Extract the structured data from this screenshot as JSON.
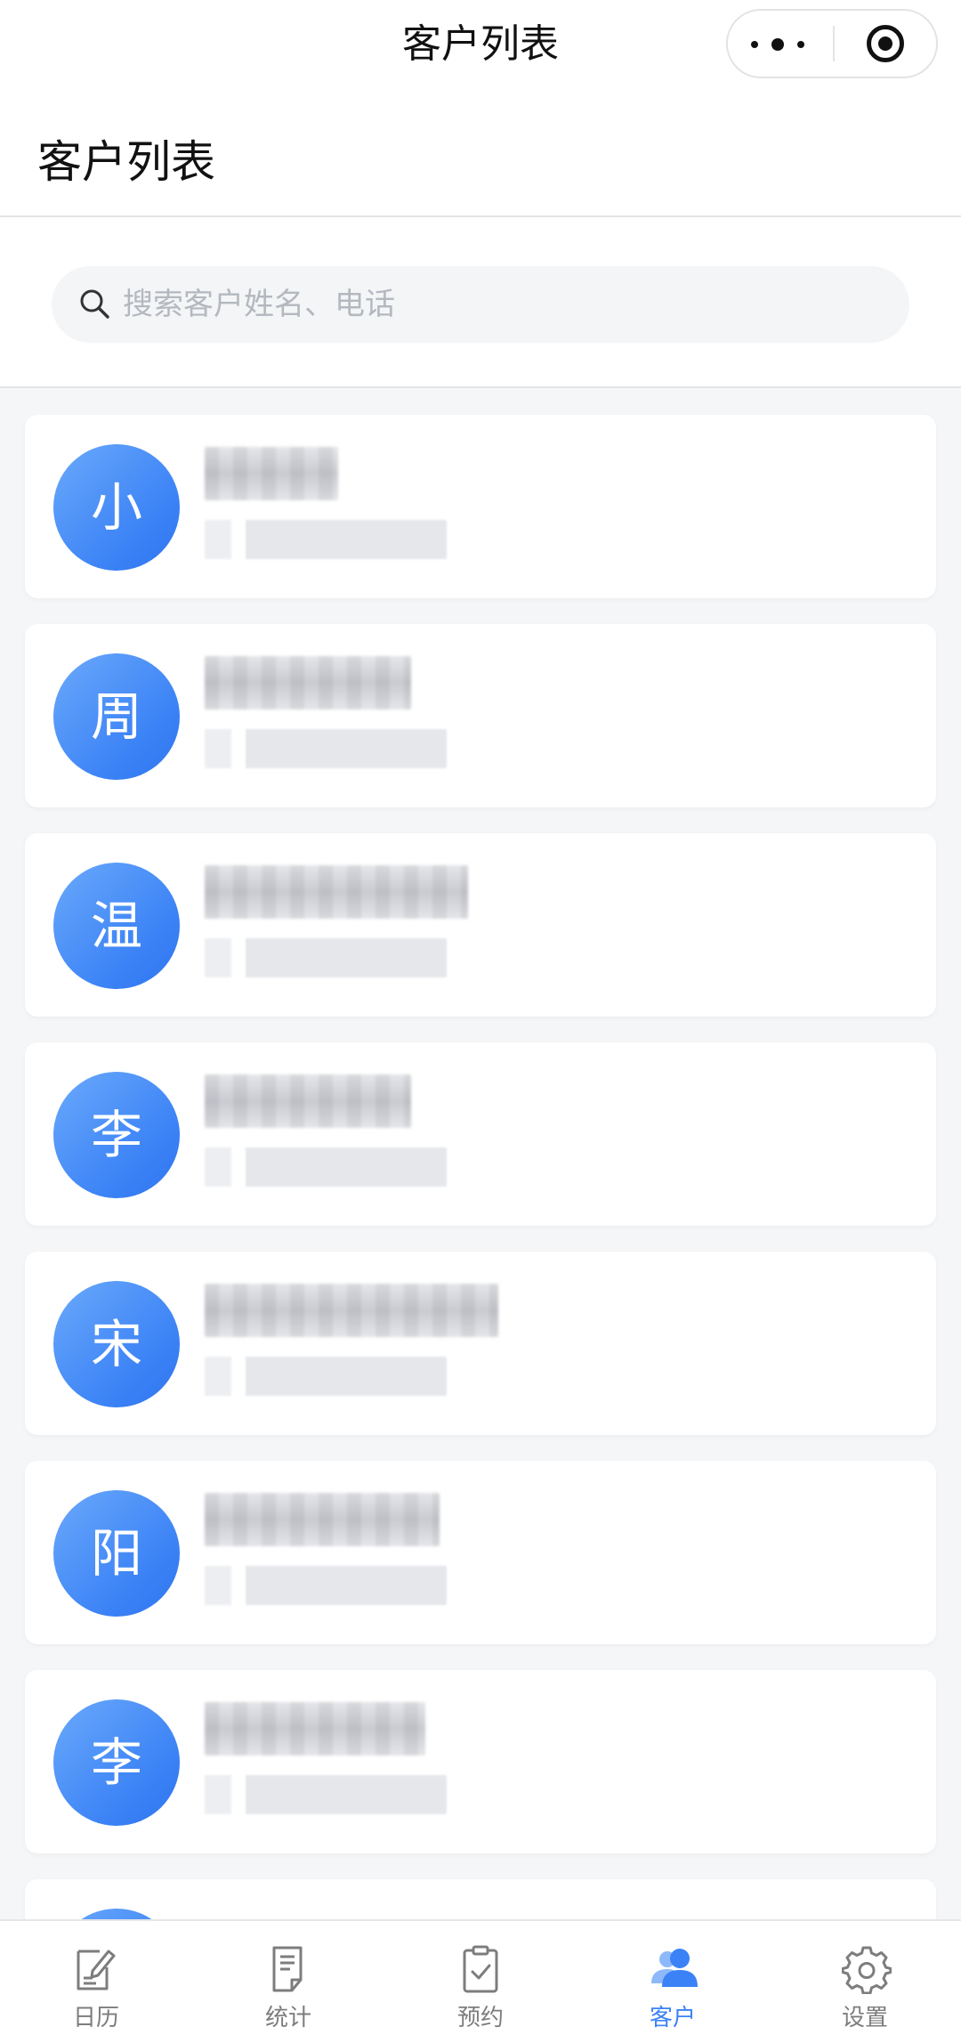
{
  "navbar": {
    "title": "客户列表",
    "more_icon": "more-dots-icon",
    "close_icon": "mini-program-close-icon"
  },
  "page": {
    "title": "客户列表"
  },
  "search": {
    "placeholder": "搜索客户姓名、电话",
    "value": "",
    "icon": "search-icon"
  },
  "customers": [
    {
      "avatar": "小"
    },
    {
      "avatar": "周"
    },
    {
      "avatar": "温"
    },
    {
      "avatar": "李"
    },
    {
      "avatar": "宋"
    },
    {
      "avatar": "阳"
    },
    {
      "avatar": "李"
    },
    {
      "avatar": ""
    }
  ],
  "tabbar": {
    "items": [
      {
        "label": "日历",
        "icon": "calendar-edit-icon",
        "active": false
      },
      {
        "label": "统计",
        "icon": "report-icon",
        "active": false
      },
      {
        "label": "预约",
        "icon": "clipboard-check-icon",
        "active": false
      },
      {
        "label": "客户",
        "icon": "customers-icon",
        "active": true
      },
      {
        "label": "设置",
        "icon": "settings-gear-icon",
        "active": false
      }
    ]
  },
  "colors": {
    "accent": "#3b82f6",
    "tab_inactive": "#7d7d7d",
    "background": "#f5f6f8"
  }
}
